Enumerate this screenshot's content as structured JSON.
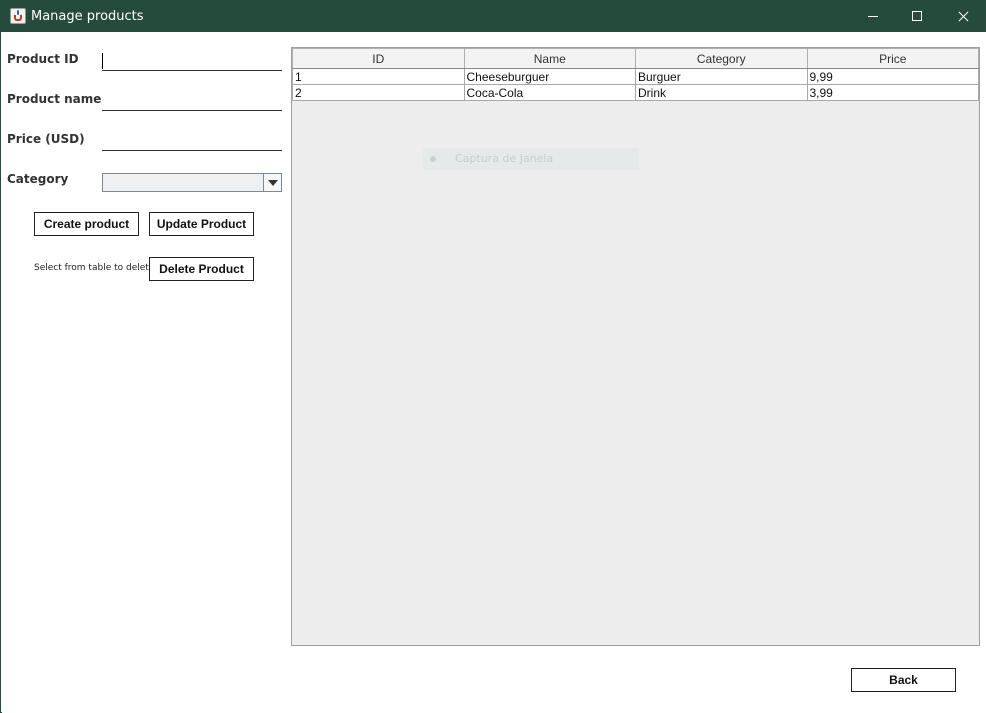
{
  "window": {
    "title": "Manage products"
  },
  "form": {
    "product_id_label": "Product ID",
    "product_id_value": "",
    "product_name_label": "Product name",
    "product_name_value": "",
    "price_label": "Price (USD)",
    "price_value": "",
    "category_label": "Category",
    "category_value": ""
  },
  "buttons": {
    "create": "Create product",
    "update": "Update Product",
    "delete": "Delete Product",
    "back": "Back"
  },
  "delete_hint": "Select from table to delete",
  "table": {
    "columns": [
      "ID",
      "Name",
      "Category",
      "Price"
    ],
    "rows": [
      [
        "1",
        "Cheeseburguer",
        "Burguer",
        "9,99"
      ],
      [
        "2",
        "Coca-Cola",
        "Drink",
        "3,99"
      ]
    ]
  },
  "overlay": {
    "label": "Captura de Janela"
  },
  "icons": {
    "app": "java-cup-icon",
    "minimize": "minimize-icon",
    "maximize": "maximize-icon",
    "close": "close-icon",
    "dropdown": "chevron-down-icon"
  },
  "colors": {
    "titlebar": "#244b3c",
    "table_bg": "#ededed"
  }
}
